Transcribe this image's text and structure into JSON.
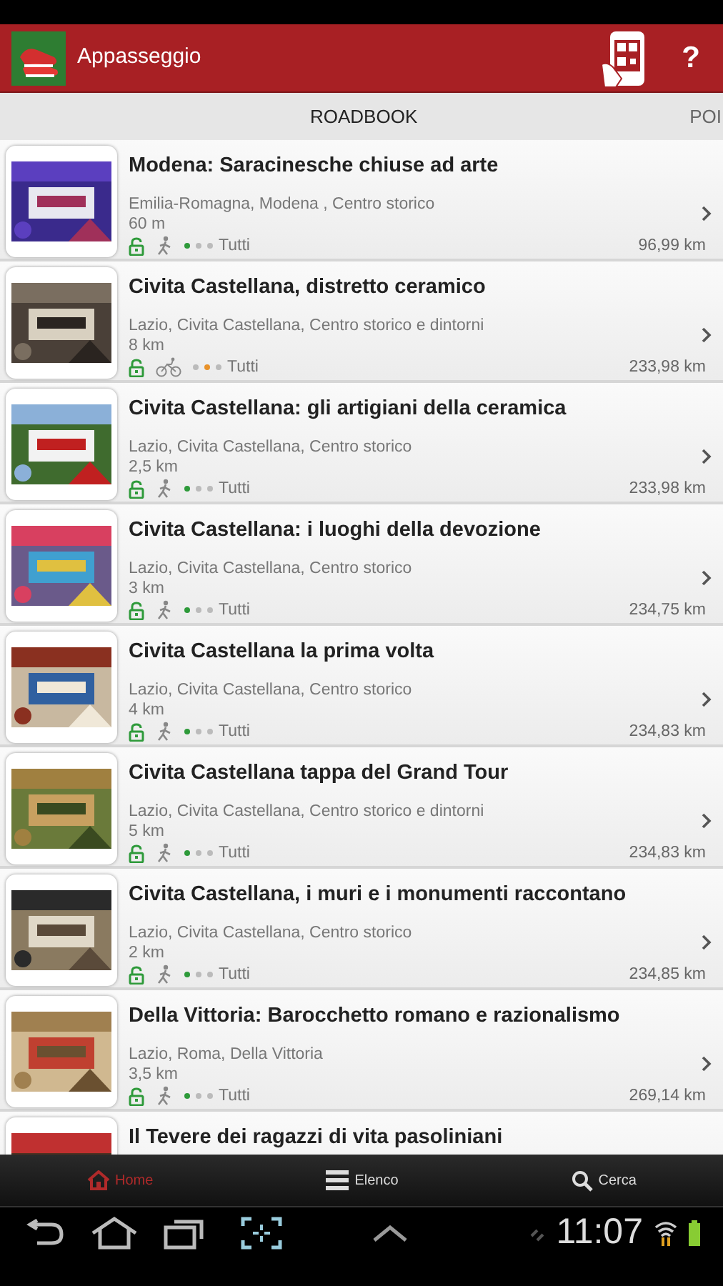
{
  "app_bar": {
    "title": "Appasseggio",
    "help": "?"
  },
  "tabs": [
    {
      "label": "ROADBOOK"
    },
    {
      "label": "POI"
    }
  ],
  "routes": [
    {
      "title": "Modena: Saracinesche chiuse ad arte",
      "place": "Emilia-Romagna, Modena , Centro storico",
      "length": "60 m",
      "kind": "walk",
      "dots": [
        {
          "color": "#2e9a3a"
        },
        {
          "color": "#bbbbbb"
        },
        {
          "color": "#bbbbbb"
        }
      ],
      "audience": "Tutti",
      "distance": "96,99 km"
    },
    {
      "title": "Civita Castellana, distretto ceramico",
      "place": "Lazio, Civita Castellana, Centro storico e dintorni",
      "length": "8 km",
      "kind": "bike",
      "dots": [
        {
          "color": "#bbbbbb"
        },
        {
          "color": "#e8922a"
        },
        {
          "color": "#bbbbbb"
        }
      ],
      "audience": "Tutti",
      "distance": "233,98 km"
    },
    {
      "title": "Civita Castellana: gli artigiani della ceramica",
      "place": "Lazio, Civita Castellana, Centro storico",
      "length": "2,5 km",
      "kind": "walk",
      "dots": [
        {
          "color": "#2e9a3a"
        },
        {
          "color": "#bbbbbb"
        },
        {
          "color": "#bbbbbb"
        }
      ],
      "audience": "Tutti",
      "distance": "233,98 km"
    },
    {
      "title": "Civita Castellana: i luoghi della devozione",
      "place": "Lazio, Civita Castellana, Centro storico",
      "length": "3 km",
      "kind": "walk",
      "dots": [
        {
          "color": "#2e9a3a"
        },
        {
          "color": "#bbbbbb"
        },
        {
          "color": "#bbbbbb"
        }
      ],
      "audience": "Tutti",
      "distance": "234,75 km"
    },
    {
      "title": "Civita Castellana la prima volta",
      "place": "Lazio, Civita Castellana, Centro storico",
      "length": "4 km",
      "kind": "walk",
      "dots": [
        {
          "color": "#2e9a3a"
        },
        {
          "color": "#bbbbbb"
        },
        {
          "color": "#bbbbbb"
        }
      ],
      "audience": "Tutti",
      "distance": "234,83 km"
    },
    {
      "title": "Civita Castellana tappa del Grand Tour",
      "place": "Lazio, Civita Castellana, Centro storico e dintorni",
      "length": "5 km",
      "kind": "walk",
      "dots": [
        {
          "color": "#2e9a3a"
        },
        {
          "color": "#bbbbbb"
        },
        {
          "color": "#bbbbbb"
        }
      ],
      "audience": "Tutti",
      "distance": "234,83 km"
    },
    {
      "title": "Civita Castellana, i muri e i monumenti raccontano",
      "place": "Lazio, Civita Castellana, Centro storico",
      "length": "2 km",
      "kind": "walk",
      "dots": [
        {
          "color": "#2e9a3a"
        },
        {
          "color": "#bbbbbb"
        },
        {
          "color": "#bbbbbb"
        }
      ],
      "audience": "Tutti",
      "distance": "234,85 km"
    },
    {
      "title": "Della Vittoria: Barocchetto romano e razionalismo",
      "place": "Lazio, Roma, Della Vittoria",
      "length": "3,5 km",
      "kind": "walk",
      "dots": [
        {
          "color": "#2e9a3a"
        },
        {
          "color": "#bbbbbb"
        },
        {
          "color": "#bbbbbb"
        }
      ],
      "audience": "Tutti",
      "distance": "269,14 km"
    },
    {
      "title": "Il Tevere dei ragazzi di vita pasoliniani"
    }
  ],
  "bottom_nav": [
    {
      "label": "Home",
      "selected": true
    },
    {
      "label": "Elenco",
      "selected": false
    },
    {
      "label": "Cerca",
      "selected": false
    }
  ],
  "system_bar": {
    "time": "11:07"
  }
}
